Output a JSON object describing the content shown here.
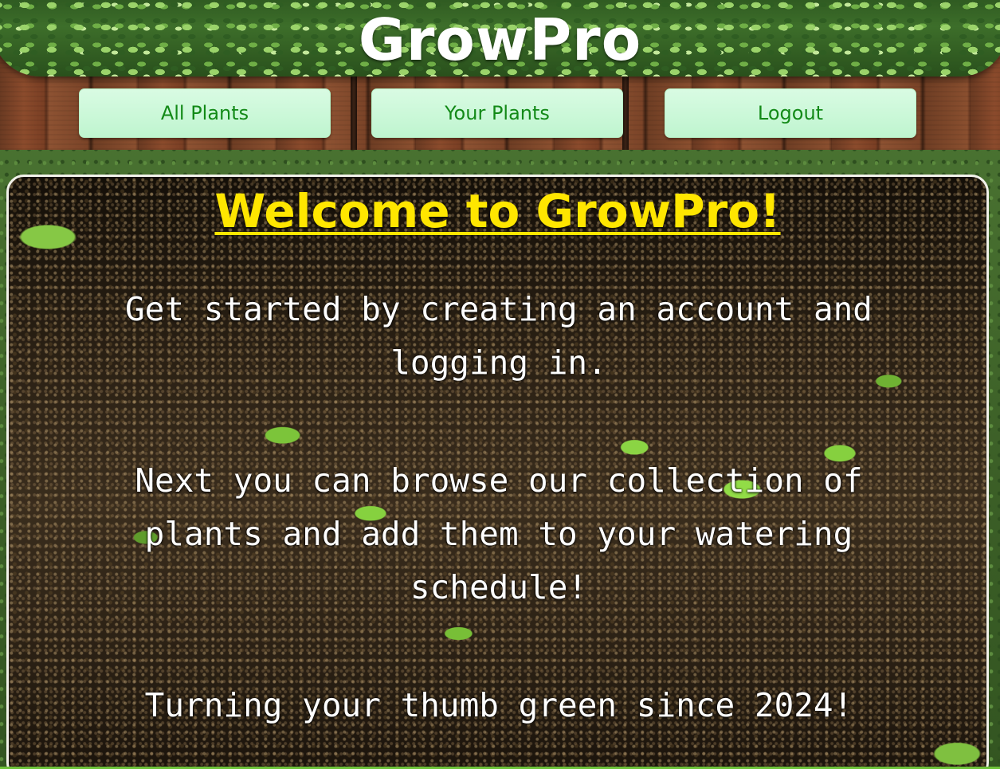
{
  "header": {
    "logo": "GrowPro"
  },
  "nav": {
    "items": [
      {
        "label": "All Plants"
      },
      {
        "label": "Your Plants"
      },
      {
        "label": "Logout"
      }
    ]
  },
  "main": {
    "title": "Welcome to GrowPro!",
    "paragraphs": [
      "Get started by creating an account and logging in.",
      "Next you can browse our collection of plants and add them to your watering schedule!",
      "Turning your thumb green since 2024!"
    ]
  },
  "colors": {
    "title": "#ffe600",
    "nav_text": "#138a17",
    "nav_bg": "#c8f7d6",
    "body_text": "#ffffff"
  }
}
